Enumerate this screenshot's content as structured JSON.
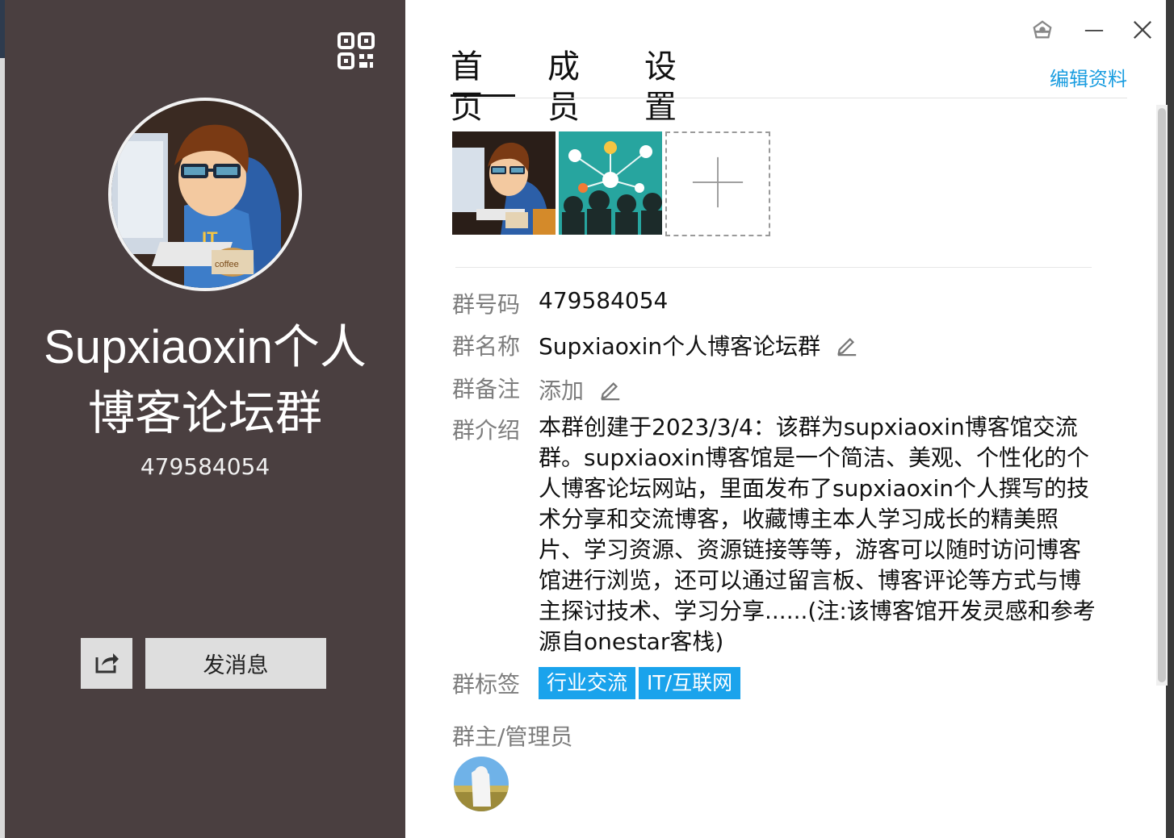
{
  "left_panel": {
    "group_name": "Supxiaoxin个人博客论坛群",
    "group_id": "479584054",
    "send_message_label": "发消息",
    "qr_icon": "qr-code-icon",
    "share_icon": "share-icon"
  },
  "window_controls": {
    "pin_icon": "pin-icon",
    "minimize_icon": "minimize-icon",
    "close_icon": "close-icon"
  },
  "tabs": [
    {
      "label": "首页",
      "active": true
    },
    {
      "label": "成员",
      "active": false
    },
    {
      "label": "设置",
      "active": false
    }
  ],
  "edit_profile_label": "编辑资料",
  "photos": {
    "add_icon": "plus-icon"
  },
  "info": {
    "group_id_label": "群号码",
    "group_id_value": "479584054",
    "group_name_label": "群名称",
    "group_name_value": "Supxiaoxin个人博客论坛群",
    "remark_label": "群备注",
    "remark_value": "添加",
    "intro_label": "群介绍",
    "intro_value": "本群创建于2023/3/4：该群为supxiaoxin博客馆交流群。supxiaoxin博客馆是一个简洁、美观、个性化的个人博客论坛网站，里面发布了supxiaoxin个人撰写的技术分享和交流博客，收藏博主本人学习成长的精美照片、学习资源、资源链接等等，游客可以随时访问博客馆进行浏览，还可以通过留言板、博客评论等方式与博主探讨技术、学习分享......(注:该博客馆开发灵感和参考源自onestar客栈)",
    "tags_label": "群标签",
    "tags": [
      "行业交流",
      "IT/互联网"
    ],
    "admins_label": "群主/管理员"
  },
  "colors": {
    "left_bg": "#4a3f40",
    "accent": "#1a9de0",
    "tag_bg": "#1aa3ec"
  }
}
